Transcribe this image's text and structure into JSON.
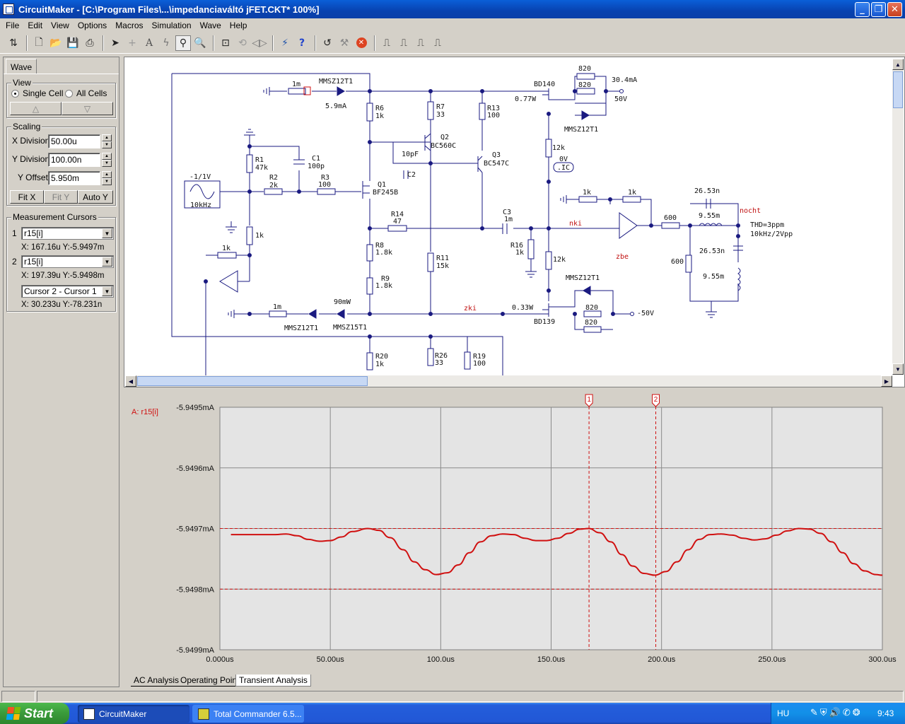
{
  "window": {
    "title": "CircuitMaker - [C:\\Program Files\\...\\impedanciaváltó jFET.CKT* 100%]",
    "buttons": [
      "_",
      "❐",
      "✕"
    ]
  },
  "menu": [
    "File",
    "Edit",
    "View",
    "Options",
    "Macros",
    "Simulation",
    "Wave",
    "Help"
  ],
  "toolbar": {
    "icons": [
      "switch-icon",
      "new-icon",
      "open-icon",
      "save-icon",
      "print-icon",
      "arrow-icon",
      "wire-icon",
      "text-icon",
      "probe-icon",
      "scope-probe-icon",
      "zoom-icon",
      "zoom-fit-icon",
      "rotate-icon",
      "mirror-icon",
      "run-icon",
      "help-icon",
      "undo-icon",
      "fault-icon",
      "stop-icon",
      "wave1-icon",
      "wave2-icon",
      "wave3-icon",
      "wave4-icon"
    ]
  },
  "panel": {
    "tab": "Wave",
    "view": {
      "title": "View",
      "single_cell": "Single Cell",
      "all_cells": "All Cells",
      "selected": "single_cell"
    },
    "scaling": {
      "title": "Scaling",
      "x_label": "X Division",
      "x_value": "50.00u",
      "y_label": "Y Division",
      "y_value": "100.00n",
      "offset_label": "Y Offset",
      "offset_value": "5.950m",
      "fit_x": "Fit X",
      "fit_y": "Fit Y",
      "auto_y": "Auto Y"
    },
    "cursors": {
      "title": "Measurement Cursors",
      "c1_num": "1",
      "c1_signal": "r15[i]",
      "c1_readout": "X: 167.16u  Y:-5.9497m",
      "c2_num": "2",
      "c2_signal": "r15[i]",
      "c2_readout": "X: 197.39u  Y:-5.9498m",
      "diff_mode": "Cursor 2 - Cursor 1",
      "diff_readout": "X: 30.233u  Y:-78.231n"
    }
  },
  "schematic": {
    "labels": {
      "mmsz_top": "MMSZ12T1",
      "r_1m_top": "1m",
      "cur_5_9": "5.9mA",
      "r6": "R6",
      "r6v": "1k",
      "r7": "R7",
      "r7v": "33",
      "r13": "R13",
      "r13v": "100",
      "bd140": "BD140",
      "w077": "0.77W",
      "r820a": "820",
      "r820b": "820",
      "ma304": "30.4mA",
      "v50": "50V",
      "mmsz_right": "MMSZ12T1",
      "q2": "Q2",
      "q2t": "BC560C",
      "c10p": "10pF",
      "c2": "C2",
      "q3": "Q3",
      "q3t": "BC547C",
      "r12k_a": "12k",
      "v0": "0V",
      "ic": ".IC",
      "r1": "R1",
      "r1v": "47k",
      "c1": "C1",
      "c1v": "100p",
      "r2": "R2",
      "r2v": "2k",
      "r3": "R3",
      "r3v": "100",
      "q1": "Q1",
      "q1t": "BF245B",
      "src_v": "-1/1V",
      "src_f": "10kHz",
      "r14": "R14",
      "r14v": "47",
      "c3": "C3",
      "c3v": "1m",
      "nki": "nki",
      "r_1k_opa": "1k",
      "r_1k_opb": "1k",
      "r600a": "600",
      "c2653a": "26.53n",
      "l955a": "9.55m",
      "nocht": "nocht",
      "thd": "THD=3ppm",
      "thd2": "10kHz/2Vpp",
      "r1k_mid": "1k",
      "r16": "R16",
      "r16v": "1k",
      "r12k_b": "12k",
      "zbe": "zbe",
      "r8": "R8",
      "r8v": "1.8k",
      "r11": "R11",
      "r11v": "15k",
      "r9": "R9",
      "r9v": "1.8k",
      "r600b": "600",
      "c2653b": "26.53n",
      "l955b": "9.55m",
      "r1k_fb": "1k",
      "mmsz_bd139": "MMSZ12T1",
      "r_1m_bot": "1m",
      "mw90": "90mW",
      "zki": "zki",
      "w033": "0.33W",
      "r820c": "820",
      "r820d": "820",
      "vm50": "-50V",
      "mmsz_bot1": "MMSZ12T1",
      "mmsz_bot2": "MMSZ15T1",
      "bd139": "BD139",
      "r20": "R20",
      "r20v": "1k",
      "r26": "R26",
      "r26v": "33",
      "r19": "R19",
      "r19v": "100"
    }
  },
  "chart_data": {
    "type": "line",
    "trace_label": "A: r15[i]",
    "xlabel": "",
    "ylabel": "",
    "x_ticks": [
      "0.000us",
      "50.00us",
      "100.0us",
      "150.0us",
      "200.0us",
      "250.0us",
      "300.0us"
    ],
    "y_ticks": [
      "-5.9495mA",
      "-5.9496mA",
      "-5.9497mA",
      "-5.9498mA",
      "-5.9499mA"
    ],
    "xlim": [
      0,
      300
    ],
    "ylim": [
      -5.9499,
      -5.9495
    ],
    "grid": true,
    "series": [
      {
        "name": "r15[i]",
        "color": "#d01010",
        "x": [
          5,
          15,
          25,
          30,
          35,
          40,
          45,
          50,
          55,
          60,
          67,
          72,
          77,
          83,
          88,
          93,
          98,
          103,
          108,
          113,
          118,
          123,
          128,
          133,
          138,
          143,
          148,
          153,
          158,
          163,
          167,
          172,
          177,
          182,
          187,
          192,
          197,
          202,
          207,
          212,
          217,
          222,
          227,
          232,
          237,
          242,
          247,
          252,
          257,
          262,
          267,
          272,
          277,
          282,
          287,
          292,
          297,
          300
        ],
        "values": [
          -5.94971,
          -5.94971,
          -5.94971,
          -5.949709,
          -5.949712,
          -5.949718,
          -5.949721,
          -5.94972,
          -5.949714,
          -5.949705,
          -5.9497,
          -5.949703,
          -5.949715,
          -5.949735,
          -5.949755,
          -5.949768,
          -5.949776,
          -5.949773,
          -5.94976,
          -5.94974,
          -5.949722,
          -5.949712,
          -5.949709,
          -5.94971,
          -5.949716,
          -5.94972,
          -5.94972,
          -5.949716,
          -5.949708,
          -5.949701,
          -5.9497,
          -5.949707,
          -5.949722,
          -5.949743,
          -5.949762,
          -5.949774,
          -5.949777,
          -5.949771,
          -5.949755,
          -5.949735,
          -5.949718,
          -5.94971,
          -5.949709,
          -5.949711,
          -5.949716,
          -5.949719,
          -5.949717,
          -5.949711,
          -5.949704,
          -5.9497,
          -5.949701,
          -5.949708,
          -5.949722,
          -5.94974,
          -5.949758,
          -5.94977,
          -5.949776,
          -5.949777
        ]
      }
    ],
    "cursors": [
      {
        "label": "1",
        "x": 167.16,
        "y": -5.9497
      },
      {
        "label": "2",
        "x": 197.39,
        "y": -5.9498
      }
    ]
  },
  "bottom_tabs": [
    "AC Analysis",
    "Operating Point",
    "Transient Analysis"
  ],
  "taskbar": {
    "start": "Start",
    "tasks": [
      "CircuitMaker",
      "Total Commander 6.5..."
    ],
    "lang": "HU",
    "clock": "9:43"
  }
}
